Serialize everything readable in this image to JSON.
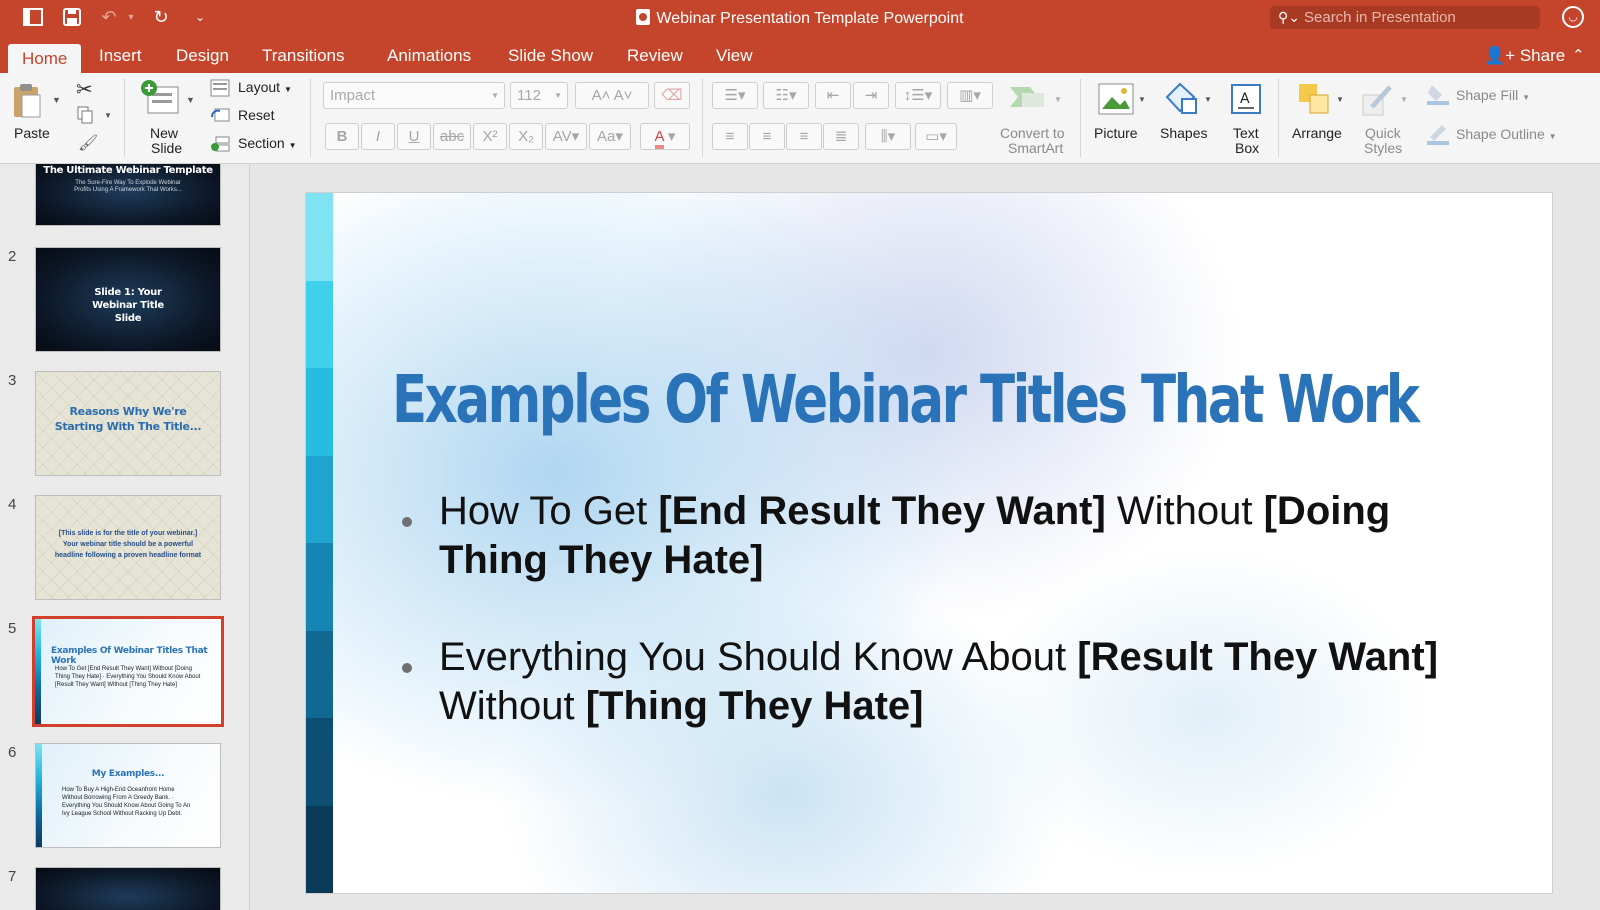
{
  "app": {
    "window_title": "Webinar Presentation Template Powerpoint",
    "search_placeholder": "Search in Presentation",
    "share_label": "Share"
  },
  "tabs": [
    "Home",
    "Insert",
    "Design",
    "Transitions",
    "Animations",
    "Slide Show",
    "Review",
    "View"
  ],
  "active_tab": "Home",
  "ribbon": {
    "paste": "Paste",
    "new_slide": [
      "New",
      "Slide"
    ],
    "layout": "Layout",
    "reset": "Reset",
    "section": "Section",
    "font_name": "Impact",
    "font_size": "112",
    "convert": [
      "Convert to",
      "SmartArt"
    ],
    "picture": "Picture",
    "shapes": "Shapes",
    "text_box": [
      "Text",
      "Box"
    ],
    "arrange": "Arrange",
    "quick_styles": [
      "Quick",
      "Styles"
    ],
    "shape_fill": "Shape Fill",
    "shape_outline": "Shape Outline",
    "format_buttons": [
      "B",
      "I",
      "U",
      "abc",
      "X²",
      "X₂"
    ]
  },
  "thumbnails": [
    {
      "num": "",
      "style": "dark",
      "title": "The Ultimate Webinar Template",
      "sub": "The Sure-Fire Way To Explode Webinar Profits Using A Framework That Works..."
    },
    {
      "num": "2",
      "style": "dark",
      "title": "Slide 1: Your Webinar Title Slide",
      "sub": ""
    },
    {
      "num": "3",
      "style": "paper",
      "title": "Reasons Why We're Starting With The Title...",
      "sub": ""
    },
    {
      "num": "4",
      "style": "paper",
      "title": "",
      "sub": "[This slide is for the title of your webinar.] Your webinar title should be a powerful headline following a proven headline format"
    },
    {
      "num": "5",
      "style": "light",
      "title": "Examples Of Webinar Titles That Work",
      "sub": "How To Get [End Result They Want] Without [Doing Thing They Hate] · Everything You Should Know About [Result They Want] Without [Thing They Hate]"
    },
    {
      "num": "6",
      "style": "light",
      "title": "My Examples...",
      "sub": "How To Buy A High-End Oceanfront Home Without Borrowing From A Greedy Bank. · Everything You Should Know About Going To An Ivy League School Without Racking Up Debt."
    },
    {
      "num": "7",
      "style": "dark",
      "title": "",
      "sub": ""
    }
  ],
  "selected_slide": "5",
  "slide": {
    "title": "Examples Of Webinar Titles That Work",
    "bullets": [
      {
        "parts": [
          {
            "t": "How To Get ",
            "b": false
          },
          {
            "t": "[End Result They Want]",
            "b": true
          },
          {
            "t": " Without ",
            "b": false
          },
          {
            "t": "[Doing Thing They Hate]",
            "b": true
          }
        ]
      },
      {
        "parts": [
          {
            "t": "Everything You Should Know About ",
            "b": false
          },
          {
            "t": "[Result They Want]",
            "b": true
          },
          {
            "t": " Without ",
            "b": false
          },
          {
            "t": "[Thing They Hate]",
            "b": true
          }
        ]
      }
    ]
  },
  "colors": {
    "brand": "#c4452b",
    "title_blue": "#2b73b8",
    "strip": [
      "#7fe3f3",
      "#3fd0ec",
      "#26bde0",
      "#1ea4cf",
      "#1785b4",
      "#116893",
      "#0d4e73",
      "#0a3a58"
    ]
  }
}
